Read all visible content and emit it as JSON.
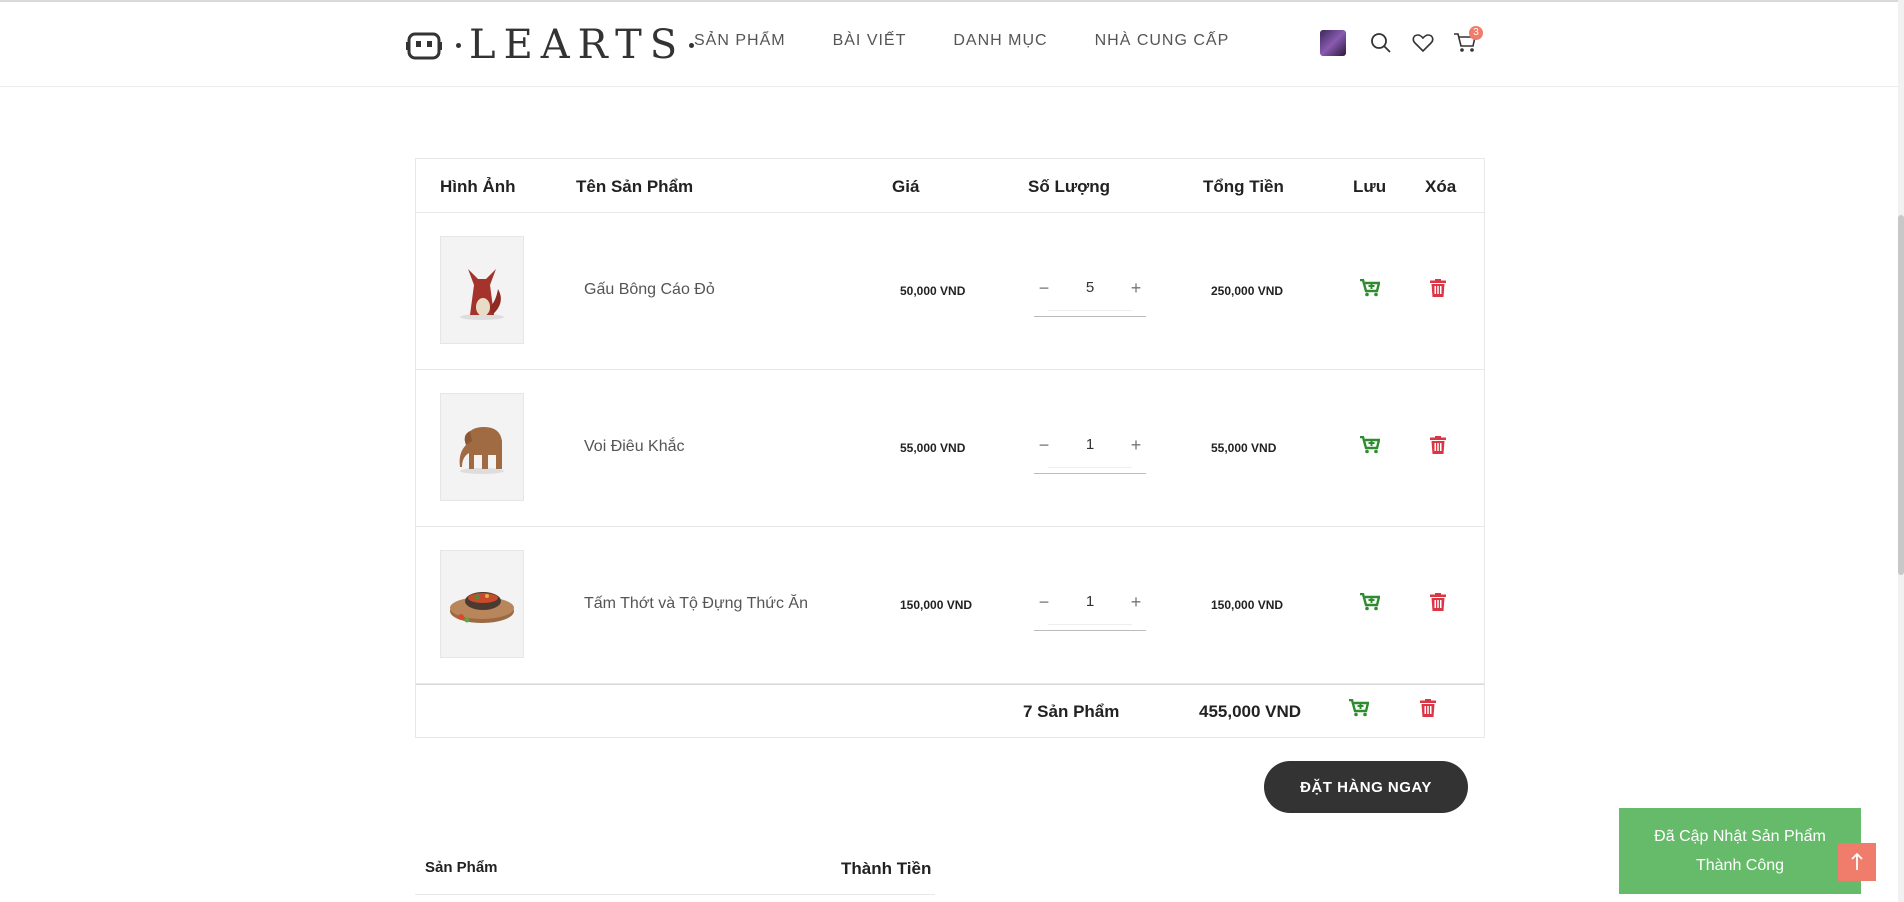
{
  "header": {
    "logo": "LEARTS",
    "nav": [
      "SẢN PHẨM",
      "BÀI VIẾT",
      "DANH MỤC",
      "NHÀ CUNG CẤP"
    ],
    "cart_count": "3"
  },
  "table": {
    "headers": {
      "image": "Hình Ảnh",
      "name": "Tên Sản Phẩm",
      "price": "Giá",
      "qty": "Số Lượng",
      "total": "Tổng Tiền",
      "save": "Lưu",
      "delete": "Xóa"
    },
    "rows": [
      {
        "name": "Gấu Bông Cáo Đỏ",
        "price": "50,000 VND",
        "qty": "5",
        "total": "250,000 VND"
      },
      {
        "name": "Voi Điêu Khắc",
        "price": "55,000 VND",
        "qty": "1",
        "total": "55,000 VND"
      },
      {
        "name": "Tấm Thớt và Tộ Đựng Thức Ăn",
        "price": "150,000 VND",
        "qty": "1",
        "total": "150,000 VND"
      }
    ],
    "qty_minus": "−",
    "qty_plus": "+",
    "footer": {
      "count": "7 Sản Phẩm",
      "sum": "455,000 VND"
    }
  },
  "order_button": "ĐẶT HÀNG NGAY",
  "summary": {
    "col1": "Sản Phẩm",
    "col2": "Thành Tiền"
  },
  "toast": {
    "line1": "Đã Cập Nhật Sản Phẩm",
    "line2": "Thành Công"
  },
  "colors": {
    "save": "#2e8b2e",
    "delete": "#dc3545",
    "toast": "#66bb6a",
    "badge": "#f07c6c"
  }
}
